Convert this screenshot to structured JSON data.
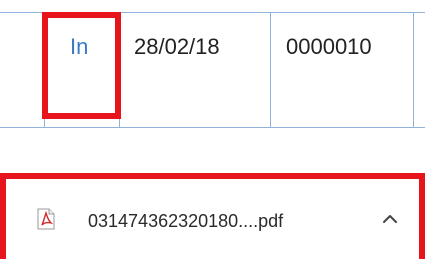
{
  "table": {
    "row": {
      "direction": "In",
      "date": "28/02/18",
      "number": "0000010"
    }
  },
  "download": {
    "file_name": "031474362320180....pdf",
    "file_icon": "pdf-file-icon",
    "toggle_icon": "chevron-up-icon"
  },
  "colors": {
    "highlight": "#e8141c",
    "grid_line": "#8fb3d9",
    "link_text": "#3b78c8"
  }
}
